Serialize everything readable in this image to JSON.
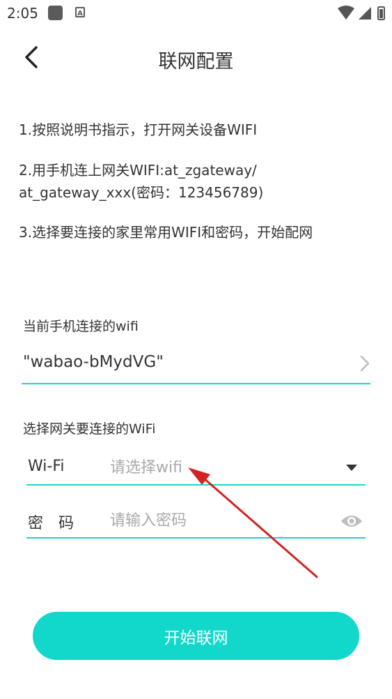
{
  "status_bar": {
    "time": "2:05",
    "status_icon_letter": "A"
  },
  "header": {
    "title": "联网配置"
  },
  "instructions": [
    "1.按照说明书指示，打开网关设备WIFI",
    "2.用手机连上网关WIFI:at_zgateway/",
    "at_gateway_xxx(密码：123456789)",
    "3.选择要连接的家里常用WIFI和密码，开始配网"
  ],
  "current_wifi": {
    "label": "当前手机连接的wifi",
    "value": "\"wabao-bMydVG\""
  },
  "gateway_wifi": {
    "label": "选择网关要连接的WiFi",
    "wifi_label": "Wi-Fi",
    "wifi_placeholder": "请选择wifi",
    "password_label": "密　码",
    "password_placeholder": "请输入密码"
  },
  "start_button": "开始联网",
  "colors": {
    "accent": "#1ED3C8",
    "button": "#12D8CC",
    "annotation_arrow": "#D32222"
  }
}
